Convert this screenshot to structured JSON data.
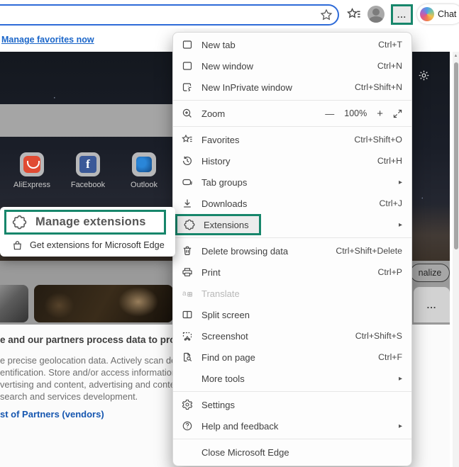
{
  "toolbar": {
    "chat_label": "Chat",
    "icons": [
      "favorite-star-icon",
      "hub-favorites-icon",
      "profile-icon",
      "more-dots-icon",
      "copilot-icon"
    ],
    "more_dots": "..."
  },
  "favorites_bar": {
    "manage_link": "Manage favorites now"
  },
  "colors": {
    "highlight_green": "#17866b",
    "addressbar_blue": "#2e6bd8",
    "link_blue": "#1b66c9",
    "cookie_link_blue": "#1556b0"
  },
  "page": {
    "shortcuts": [
      {
        "name": "AliExpress"
      },
      {
        "name": "Facebook"
      },
      {
        "name": "Outlook"
      }
    ],
    "personalize_button": "nalize",
    "more_card": "...",
    "cookie": {
      "heading": "e and our partners process data to provi",
      "lines": [
        "e precise geolocation data. Actively scan devi",
        "entification. Store and/or access information c",
        "vertising and content, advertising and conten",
        "search and services development."
      ],
      "link": "st of Partners (vendors)"
    }
  },
  "menu": {
    "items": [
      {
        "type": "item",
        "icon": "new-tab",
        "label": "New tab",
        "shortcut": "Ctrl+T"
      },
      {
        "type": "item",
        "icon": "new-window",
        "label": "New window",
        "shortcut": "Ctrl+N"
      },
      {
        "type": "item",
        "icon": "new-inprivate",
        "label": "New InPrivate window",
        "shortcut": "Ctrl+Shift+N"
      },
      {
        "type": "divider"
      },
      {
        "type": "zoom",
        "icon": "zoom",
        "label": "Zoom",
        "minus": "—",
        "value": "100%",
        "plus": "+"
      },
      {
        "type": "divider"
      },
      {
        "type": "item",
        "icon": "favorites",
        "label": "Favorites",
        "shortcut": "Ctrl+Shift+O"
      },
      {
        "type": "item",
        "icon": "history",
        "label": "History",
        "shortcut": "Ctrl+H"
      },
      {
        "type": "item",
        "icon": "tab-groups",
        "label": "Tab groups",
        "chevron": true
      },
      {
        "type": "item",
        "icon": "downloads",
        "label": "Downloads",
        "shortcut": "Ctrl+J"
      },
      {
        "type": "item",
        "icon": "extensions",
        "label": "Extensions",
        "chevron": true,
        "highlighted": true
      },
      {
        "type": "divider"
      },
      {
        "type": "item",
        "icon": "delete",
        "label": "Delete browsing data",
        "shortcut": "Ctrl+Shift+Delete"
      },
      {
        "type": "item",
        "icon": "print",
        "label": "Print",
        "shortcut": "Ctrl+P"
      },
      {
        "type": "item",
        "icon": "translate",
        "label": "Translate",
        "disabled": true
      },
      {
        "type": "item",
        "icon": "split-screen",
        "label": "Split screen"
      },
      {
        "type": "item",
        "icon": "screenshot",
        "label": "Screenshot",
        "shortcut": "Ctrl+Shift+S"
      },
      {
        "type": "item",
        "icon": "find",
        "label": "Find on page",
        "shortcut": "Ctrl+F"
      },
      {
        "type": "item",
        "icon": null,
        "label": "More tools",
        "chevron": true
      },
      {
        "type": "divider"
      },
      {
        "type": "item",
        "icon": "settings",
        "label": "Settings"
      },
      {
        "type": "item",
        "icon": "help",
        "label": "Help and feedback",
        "chevron": true
      },
      {
        "type": "divider"
      },
      {
        "type": "item",
        "icon": null,
        "label": "Close Microsoft Edge"
      }
    ]
  },
  "callout": {
    "manage_label": "Manage extensions",
    "get_label": "Get extensions for Microsoft Edge"
  },
  "scrollbar": {
    "up_arrow": "▲"
  }
}
